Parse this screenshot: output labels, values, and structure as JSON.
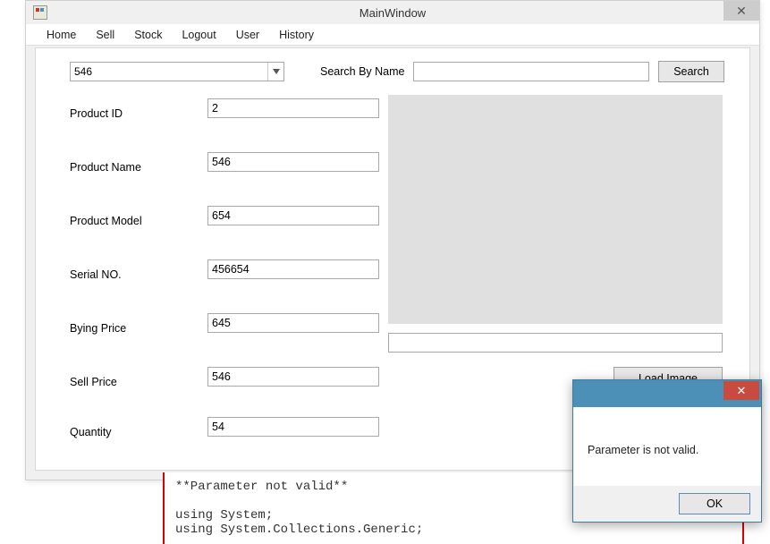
{
  "window": {
    "title": "MainWindow"
  },
  "menu": {
    "items": [
      "Home",
      "Sell",
      "Stock",
      "Logout",
      "User",
      "History"
    ]
  },
  "search": {
    "combo_value": "546",
    "by_name_label": "Search By Name",
    "by_name_value": "",
    "button": "Search"
  },
  "fields": {
    "product_id": {
      "label": "Product ID",
      "value": "2"
    },
    "product_name": {
      "label": "Product Name",
      "value": "546"
    },
    "product_model": {
      "label": "Product Model",
      "value": "654"
    },
    "serial_no": {
      "label": "Serial NO.",
      "value": "456654"
    },
    "buying_price": {
      "label": "Bying Price",
      "value": "645"
    },
    "sell_price": {
      "label": "Sell Price",
      "value": "546"
    },
    "quantity": {
      "label": "Quantity",
      "value": "54"
    }
  },
  "image_section": {
    "path_value": "",
    "load_button": "Load Image"
  },
  "code": {
    "text": "**Parameter not valid**\n\nusing System;\nusing System.Collections.Generic;"
  },
  "dialog": {
    "message": "Parameter is not valid.",
    "ok": "OK"
  }
}
